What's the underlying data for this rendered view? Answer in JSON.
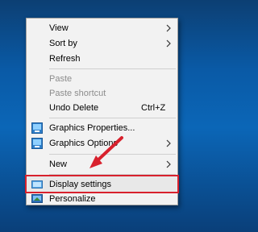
{
  "context_menu": {
    "items": [
      {
        "label": "View",
        "submenu": true
      },
      {
        "label": "Sort by",
        "submenu": true
      },
      {
        "label": "Refresh"
      },
      {
        "label": "Paste",
        "disabled": true
      },
      {
        "label": "Paste shortcut",
        "disabled": true
      },
      {
        "label": "Undo Delete",
        "shortcut": "Ctrl+Z"
      },
      {
        "label": "Graphics Properties...",
        "icon": "intel-graphics-icon"
      },
      {
        "label": "Graphics Options",
        "icon": "intel-graphics-icon",
        "submenu": true
      },
      {
        "label": "New",
        "submenu": true
      },
      {
        "label": "Display settings",
        "icon": "display-icon",
        "highlighted": true
      },
      {
        "label": "Personalize",
        "icon": "personalize-icon"
      }
    ]
  },
  "annotation": {
    "arrow_color": "#d8212d",
    "highlight_box_color": "#d8212d"
  },
  "colors": {
    "menu_bg": "#f2f2f2",
    "desktop_bg": "#0b5aa6"
  }
}
